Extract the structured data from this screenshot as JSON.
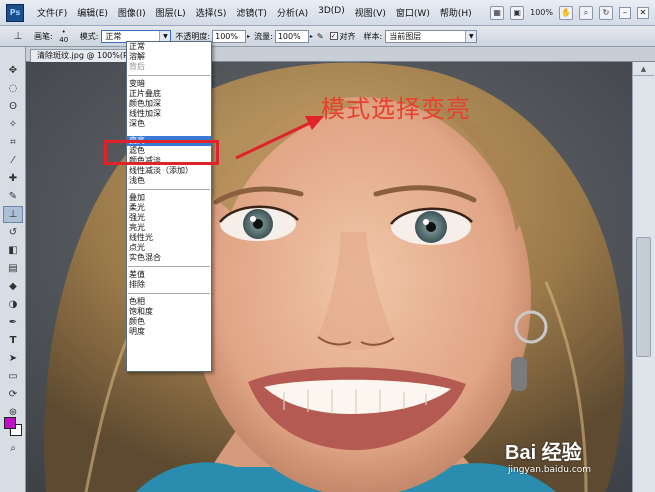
{
  "menubar": {
    "logo": "Ps",
    "items": [
      "文件(F)",
      "编辑(E)",
      "图像(I)",
      "图层(L)",
      "选择(S)",
      "滤镜(T)",
      "分析(A)",
      "3D(D)",
      "视图(V)",
      "窗口(W)",
      "帮助(H)"
    ],
    "zoom": "100%"
  },
  "options": {
    "brush_label": "画笔:",
    "brush_size": "40",
    "mode_label": "模式:",
    "mode_value": "正常",
    "opacity_label": "不透明度:",
    "opacity_value": "100%",
    "flow_label": "流量:",
    "flow_value": "100%",
    "aligned_label": "对齐",
    "sample_label": "样本:",
    "sample_value": "当前图层"
  },
  "document": {
    "tab_label": "清除斑纹.jpg @ 100%(RGB"
  },
  "dropdown": {
    "groups": [
      [
        "正常",
        "溶解",
        "背后"
      ],
      [
        "变暗",
        "正片叠底",
        "颜色加深",
        "线性加深",
        "深色"
      ],
      [
        "变亮",
        "滤色",
        "颜色减淡",
        "线性减淡（添加）",
        "浅色"
      ],
      [
        "叠加",
        "柔光",
        "强光",
        "亮光",
        "线性光",
        "点光",
        "实色混合"
      ],
      [
        "差值",
        "排除"
      ],
      [
        "色相",
        "饱和度",
        "颜色",
        "明度"
      ]
    ],
    "selected": "变亮",
    "disabled": "背后"
  },
  "annotation": {
    "text": "模式选择变亮"
  },
  "watermark": {
    "logo": "Bai 经验",
    "url": "jingyan.baidu.com"
  },
  "colors": {
    "foreground": "#c010c8",
    "background": "#ffffff",
    "annotation": "#e0232a",
    "selection": "#3a78d6"
  }
}
